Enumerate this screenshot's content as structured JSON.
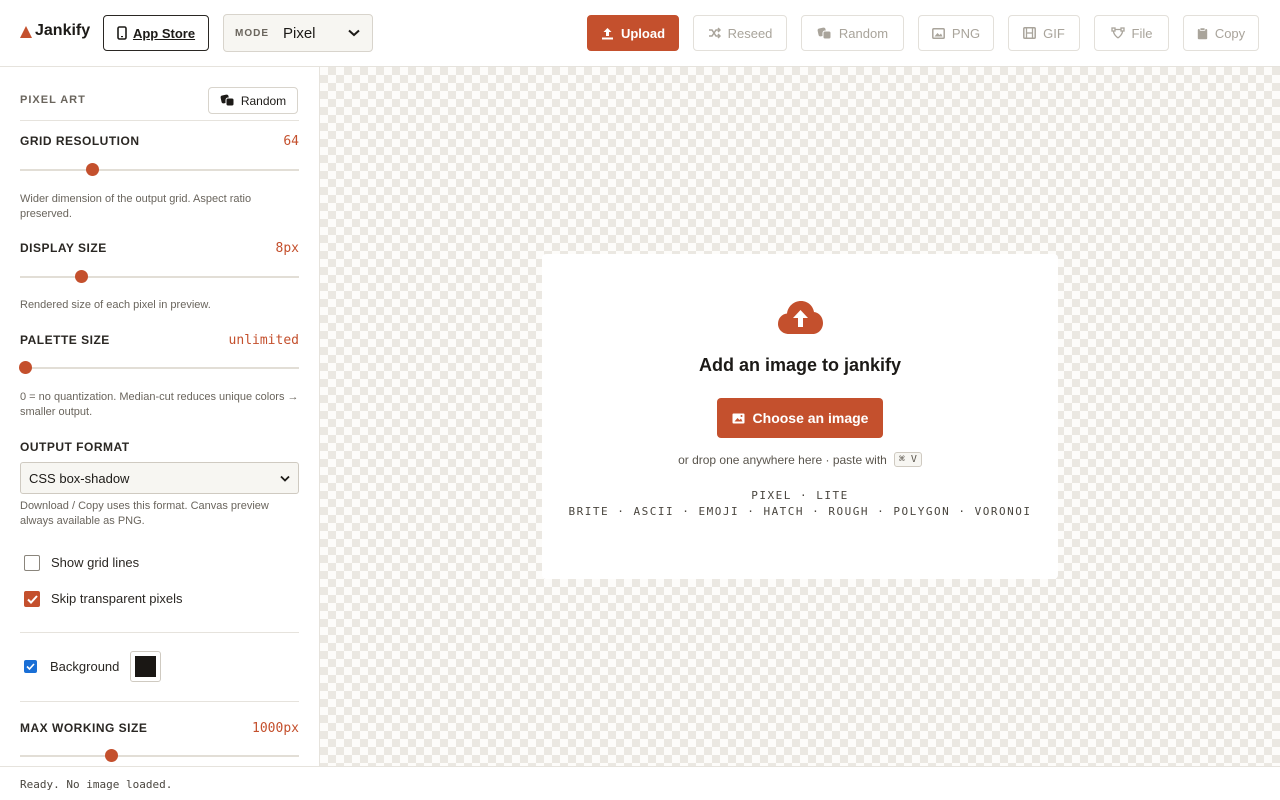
{
  "app": {
    "name": "Jankify"
  },
  "header": {
    "app_store_label": "App Store",
    "mode_label": "MODE",
    "mode_value": "Pixel",
    "upload_label": "Upload",
    "reseed_label": "Reseed",
    "random_label": "Random",
    "png_label": "PNG",
    "gif_label": "GIF",
    "file_label": "File",
    "copy_label": "Copy"
  },
  "sidebar": {
    "section_title": "PIXEL ART",
    "random_label": "Random",
    "grid_resolution": {
      "label": "GRID RESOLUTION",
      "value": "64",
      "help": "Wider dimension of the output grid. Aspect ratio preserved.",
      "level": 0.24
    },
    "display_size": {
      "label": "DISPLAY SIZE",
      "value": "8px",
      "help": "Rendered size of each pixel in preview.",
      "level": 0.2
    },
    "palette_size": {
      "label": "PALETTE SIZE",
      "value": "unlimited",
      "help": "0 = no quantization. Median-cut reduces unique colors → smaller output.",
      "level": 0.0
    },
    "output_format": {
      "label": "OUTPUT FORMAT",
      "value": "CSS box-shadow",
      "help": "Download / Copy uses this format. Canvas preview always available as PNG."
    },
    "show_grid_lines": {
      "label": "Show grid lines",
      "checked": false
    },
    "skip_transparent": {
      "label": "Skip transparent pixels",
      "checked": true
    },
    "background": {
      "label": "Background",
      "checked": true,
      "color": "#1a1714"
    },
    "max_working_size": {
      "label": "MAX WORKING SIZE",
      "value": "1000px",
      "level": 0.31
    }
  },
  "canvas": {
    "title": "Add an image to jankify",
    "choose_label": "Choose an image",
    "drop_hint": "or drop one anywhere here · paste with",
    "shortcut": "⌘ V",
    "modes_line1": "PIXEL · LITE",
    "modes_line2": "BRITE · ASCII · EMOJI · HATCH · ROUGH · POLYGON · VORONOI"
  },
  "status": {
    "text": "Ready. No image loaded."
  },
  "colors": {
    "accent": "#c4502d",
    "checker": "#ebe8e2"
  }
}
